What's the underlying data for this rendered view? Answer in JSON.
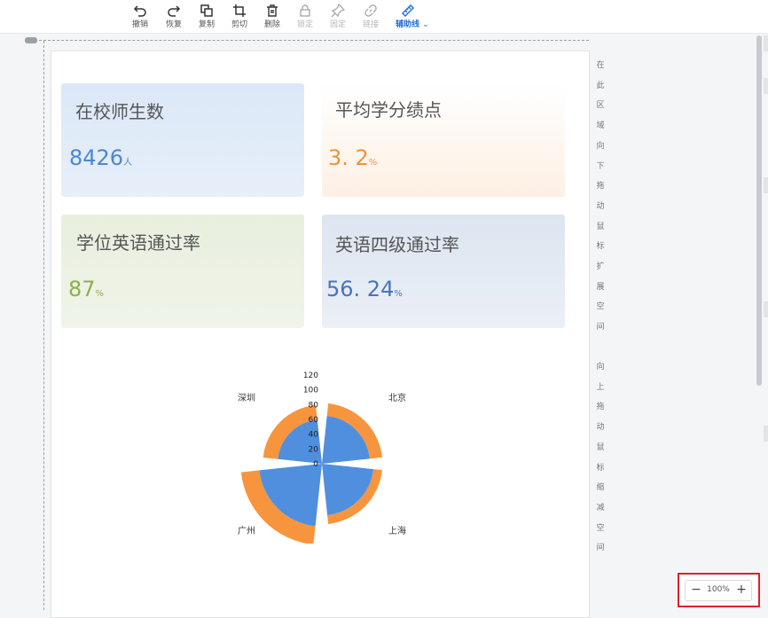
{
  "toolbar": {
    "items": [
      {
        "label": "撤销",
        "icon": "undo-icon"
      },
      {
        "label": "恢复",
        "icon": "redo-icon"
      },
      {
        "label": "复制",
        "icon": "copy-icon"
      },
      {
        "label": "剪切",
        "icon": "crop-icon"
      },
      {
        "label": "删除",
        "icon": "trash-icon"
      },
      {
        "label": "锁定",
        "icon": "lock-icon"
      },
      {
        "label": "固定",
        "icon": "pin-icon"
      },
      {
        "label": "链接",
        "icon": "link-icon"
      },
      {
        "label": "辅助线",
        "icon": "ruler-icon"
      }
    ]
  },
  "cards": [
    {
      "title": "在校师生数",
      "value": "8426",
      "unit": "人",
      "color": "#4a86d4"
    },
    {
      "title": "平均学分绩点",
      "value": "3. 2",
      "unit": "%",
      "color": "#f0923a"
    },
    {
      "title": "学位英语通过率",
      "value": "87",
      "unit": "%",
      "color": "#8fb04a"
    },
    {
      "title": "英语四级通过率",
      "value": "56. 24",
      "unit": "%",
      "color": "#4a74b8"
    }
  ],
  "chart_data": {
    "type": "polar-bar",
    "categories": [
      "北京",
      "上海",
      "广州",
      "深圳"
    ],
    "series": [
      {
        "values": [
          65,
          70,
          85,
          60
        ],
        "color": "#4f8fde"
      },
      {
        "values": [
          82,
          82,
          110,
          80
        ],
        "color": "#f7953e"
      }
    ],
    "radial_ticks": [
      "0",
      "20",
      "40",
      "60",
      "80",
      "100",
      "120"
    ],
    "rmax": 120
  },
  "side_hints": {
    "top": [
      "在",
      "此",
      "区",
      "域",
      "向",
      "下",
      "拖",
      "动",
      "鼠",
      "标",
      "扩",
      "展",
      "空",
      "间"
    ],
    "bottom": [
      "向",
      "上",
      "拖",
      "动",
      "鼠",
      "标",
      "缩",
      "减",
      "空",
      "间"
    ]
  },
  "zoom": {
    "minus": "−",
    "percent": "100%",
    "plus": "+"
  }
}
